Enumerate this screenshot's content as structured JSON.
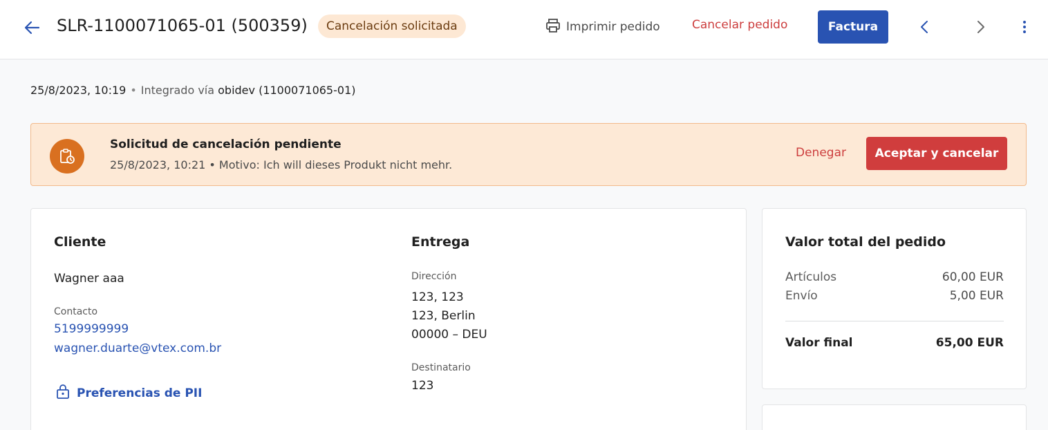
{
  "header": {
    "order_id": "SLR-1100071065-01 (500359)",
    "status": "Cancelación solicitada",
    "print_label": "Imprimir pedido",
    "cancel_label": "Cancelar pedido",
    "invoice_label": "Factura"
  },
  "meta": {
    "date": "25/8/2023, 10:19",
    "integrated_prefix": "Integrado vía",
    "integrated_source": "obidev (1100071065-01)"
  },
  "alert": {
    "title": "Solicitud de cancelación pendiente",
    "subtitle": "25/8/2023, 10:21 • Motivo: Ich will dieses Produkt nicht mehr.",
    "deny_label": "Denegar",
    "accept_label": "Aceptar y cancelar"
  },
  "customer": {
    "title": "Cliente",
    "name": "Wagner aaa",
    "contact_label": "Contacto",
    "phone": "5199999999",
    "email": "wagner.duarte@vtex.com.br",
    "pii_label": "Preferencias de PII"
  },
  "delivery": {
    "title": "Entrega",
    "address_label": "Dirección",
    "address_line1": "123, 123",
    "address_line2": "123, Berlin",
    "address_line3": "00000 – DEU",
    "recipient_label": "Destinatario",
    "recipient": "123"
  },
  "totals": {
    "title": "Valor total del pedido",
    "items_label": "Artículos",
    "items_value": "60,00 EUR",
    "shipping_label": "Envío",
    "shipping_value": "5,00 EUR",
    "final_label": "Valor final",
    "final_value": "65,00 EUR"
  },
  "colors": {
    "primary": "#2953b2",
    "danger": "#d03d3d",
    "warning_bg": "#fde9d6",
    "warning_icon": "#d97020"
  }
}
